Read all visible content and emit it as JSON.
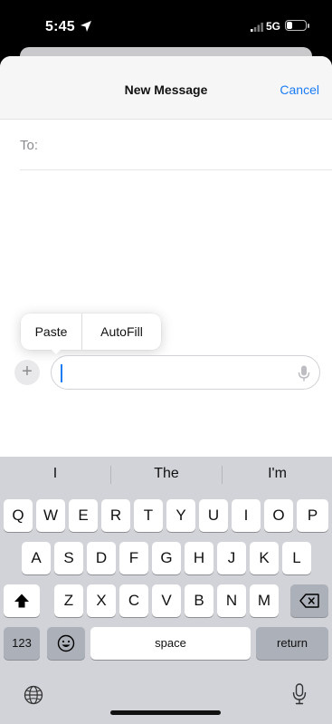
{
  "status_bar": {
    "time": "5:45",
    "network": "5G",
    "battery_level": 0.3
  },
  "nav": {
    "title": "New Message",
    "cancel_label": "Cancel"
  },
  "recipient": {
    "label": "To:"
  },
  "callout": {
    "paste_label": "Paste",
    "autofill_label": "AutoFill"
  },
  "composer": {
    "plus_label": "+",
    "value": ""
  },
  "keyboard": {
    "suggestions": [
      "I",
      "The",
      "I'm"
    ],
    "row1": [
      "Q",
      "W",
      "E",
      "R",
      "T",
      "Y",
      "U",
      "I",
      "O",
      "P"
    ],
    "row2": [
      "A",
      "S",
      "D",
      "F",
      "G",
      "H",
      "J",
      "K",
      "L"
    ],
    "row3": [
      "Z",
      "X",
      "C",
      "V",
      "B",
      "N",
      "M"
    ],
    "numbers_label": "123",
    "space_label": "space",
    "return_label": "return",
    "icons": [
      "shift-icon",
      "backspace-icon",
      "emoji-icon",
      "globe-icon",
      "dictation-mic-icon"
    ]
  },
  "colors": {
    "accent": "#1a7cf5",
    "keyboard_bg": "#d1d3d9",
    "fn_key": "#acb0b9"
  }
}
